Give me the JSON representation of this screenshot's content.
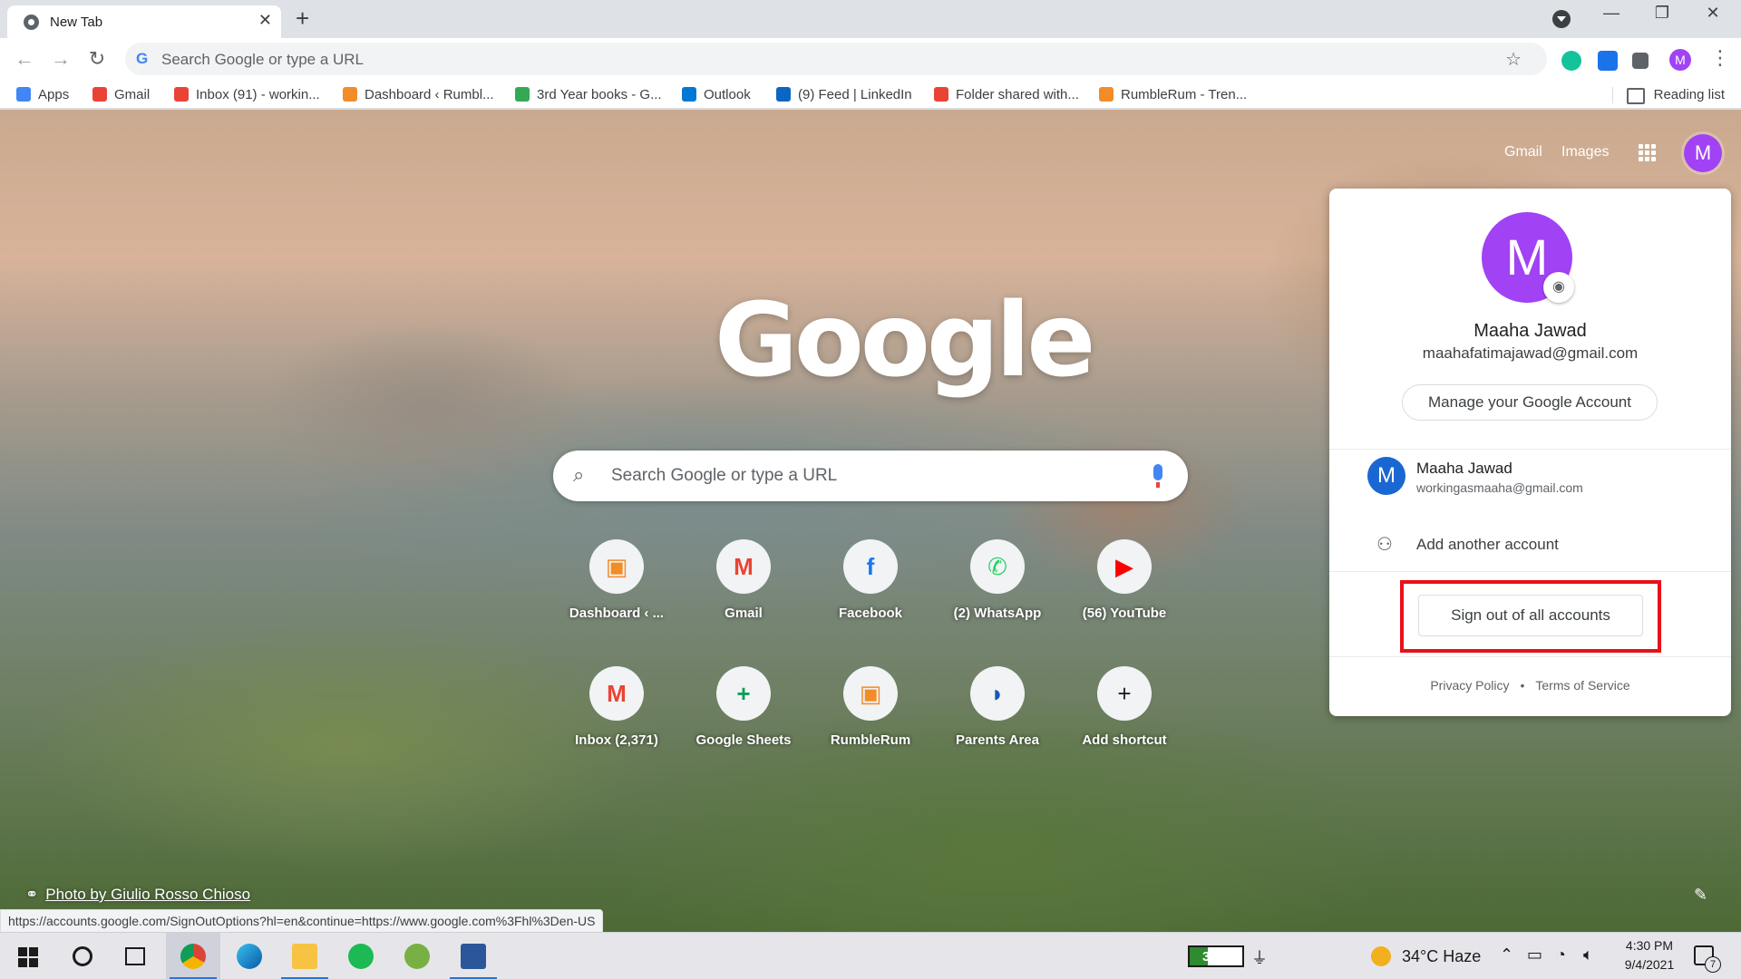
{
  "browser": {
    "tab_title": "New Tab",
    "omnibox_placeholder": "Search Google or type a URL",
    "reading_list": "Reading list"
  },
  "bookmarks": [
    {
      "label": "Apps",
      "icon": "apps-grid-icon",
      "color": "#4285f4"
    },
    {
      "label": "Gmail",
      "icon": "gmail-icon",
      "color": "#ea4335"
    },
    {
      "label": "Inbox (91) - workin...",
      "icon": "gmail-icon",
      "color": "#ea4335"
    },
    {
      "label": "Dashboard ‹ Rumbl...",
      "icon": "rumblerum-icon",
      "color": "#f28c28"
    },
    {
      "label": "3rd Year books - G...",
      "icon": "google-drive-icon",
      "color": "#34a853"
    },
    {
      "label": "Outlook",
      "icon": "outlook-icon",
      "color": "#0078d4"
    },
    {
      "label": "(9) Feed | LinkedIn",
      "icon": "linkedin-icon",
      "color": "#0a66c2"
    },
    {
      "label": "Folder shared with...",
      "icon": "gmail-icon",
      "color": "#ea4335"
    },
    {
      "label": "RumbleRum - Tren...",
      "icon": "rumblerum-icon",
      "color": "#f28c28"
    }
  ],
  "ntp": {
    "logo": "Google",
    "gmail_link": "Gmail",
    "images_link": "Images",
    "avatar_letter": "M",
    "search_placeholder": "Search Google or type a URL",
    "photo_credit": "Photo by Giulio Rosso Chioso",
    "shortcuts": [
      {
        "label": "Dashboard ‹ ...",
        "glyph": "▣",
        "color": "#f28c28"
      },
      {
        "label": "Gmail",
        "glyph": "M",
        "color": "#ea4335"
      },
      {
        "label": "Facebook",
        "glyph": "f",
        "color": "#1877f2"
      },
      {
        "label": "(2) WhatsApp",
        "glyph": "✆",
        "color": "#25d366"
      },
      {
        "label": "(56) YouTube",
        "glyph": "▶",
        "color": "#ff0000"
      },
      {
        "label": "Inbox (2,371)",
        "glyph": "M",
        "color": "#ea4335"
      },
      {
        "label": "Google Sheets",
        "glyph": "+",
        "color": "#0f9d58"
      },
      {
        "label": "RumbleRum",
        "glyph": "▣",
        "color": "#f28c28"
      },
      {
        "label": "Parents Area",
        "glyph": "◗",
        "color": "#1a56b8"
      },
      {
        "label": "Add shortcut",
        "glyph": "+",
        "color": "#202124"
      }
    ]
  },
  "account_card": {
    "avatar_letter": "M",
    "name": "Maaha Jawad",
    "email": "maahafatimajawad@gmail.com",
    "manage_label": "Manage your Google Account",
    "other_account": {
      "letter": "M",
      "name": "Maaha Jawad",
      "email": "workingasmaaha@gmail.com"
    },
    "add_account_label": "Add another account",
    "signout_label": "Sign out of all accounts",
    "privacy": "Privacy Policy",
    "separator": "•",
    "terms": "Terms of Service"
  },
  "status_url": "https://accounts.google.com/SignOutOptions?hl=en&continue=https://www.google.com%3Fhl%3Den-US",
  "taskbar": {
    "battery_percent": "35%",
    "battery_level": 0.35,
    "weather": "34°C  Haze",
    "time": "4:30 PM",
    "date": "9/4/2021",
    "notification_count": "7"
  }
}
